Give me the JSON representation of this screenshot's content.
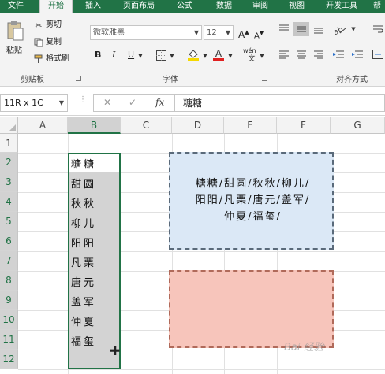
{
  "ribbon_tabs": [
    "文件",
    "开始",
    "插入",
    "页面布局",
    "公式",
    "数据",
    "审阅",
    "视图",
    "开发工具",
    "帮"
  ],
  "active_tab": "开始",
  "clipboard": {
    "paste_label": "粘贴",
    "cut_label": "剪切",
    "copy_label": "复制",
    "format_painter_label": "格式刷",
    "group_label": "剪贴板"
  },
  "font": {
    "family": "微软雅黑",
    "size": "12",
    "grow_label": "A",
    "shrink_label": "A",
    "bold": "B",
    "italic": "I",
    "underline": "U",
    "font_color_label": "A",
    "phonetic_label": "wén",
    "group_label": "字体"
  },
  "alignment": {
    "group_label": "对齐方式"
  },
  "formula_bar": {
    "name_box": "11R x 1C",
    "cancel": "✕",
    "enter": "✓",
    "fx": "fx",
    "content": "糖糖"
  },
  "columns": [
    "A",
    "B",
    "C",
    "D",
    "E",
    "F",
    "G"
  ],
  "rows": [
    "1",
    "2",
    "3",
    "4",
    "5",
    "6",
    "7",
    "8",
    "9",
    "10",
    "11",
    "12"
  ],
  "column_b_values": [
    "糖糖",
    "甜圆",
    "秋秋",
    "柳儿",
    "阳阳",
    "凡栗",
    "唐元",
    "盖军",
    "仲夏",
    "福玺"
  ],
  "textbox_lines": [
    "糖糖/甜圆/秋秋/柳儿/",
    "阳阳/凡栗/唐元/盖军/",
    "仲夏/福玺/"
  ],
  "watermark": "Bai 经验",
  "colors": {
    "excel_green": "#217346",
    "textbox_blue": "#dbe8f6",
    "textbox_pink": "#f7c5bb",
    "selection_gray": "#d3d3d3"
  }
}
